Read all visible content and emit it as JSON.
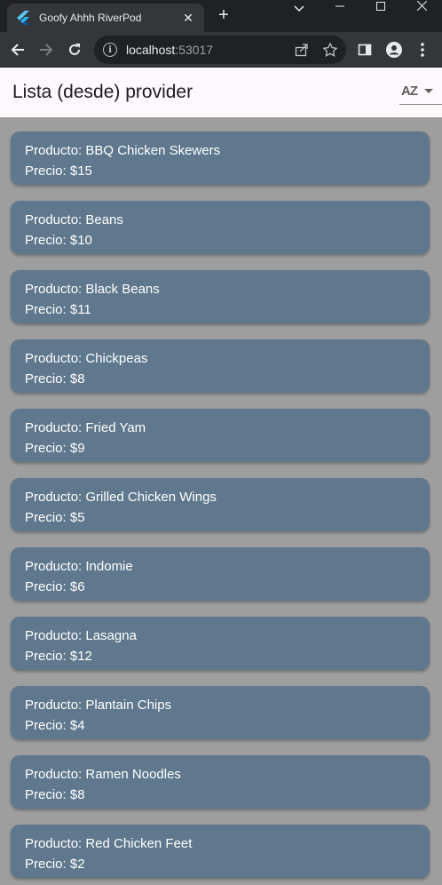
{
  "browser": {
    "tab_title": "Goofy Ahhh RiverPod",
    "url_host": "localhost",
    "url_port": ":53017"
  },
  "app": {
    "title": "Lista (desde) provider",
    "sort_icon": "AZ"
  },
  "products": [
    {
      "name": "Producto: BBQ Chicken Skewers",
      "price": "Precio: $15"
    },
    {
      "name": "Producto: Beans",
      "price": "Precio: $10"
    },
    {
      "name": "Producto: Black Beans",
      "price": "Precio: $11"
    },
    {
      "name": "Producto: Chickpeas",
      "price": "Precio: $8"
    },
    {
      "name": "Producto: Fried Yam",
      "price": "Precio: $9"
    },
    {
      "name": "Producto: Grilled Chicken Wings",
      "price": "Precio: $5"
    },
    {
      "name": "Producto: Indomie",
      "price": "Precio: $6"
    },
    {
      "name": "Producto: Lasagna",
      "price": "Precio: $12"
    },
    {
      "name": "Producto: Plantain Chips",
      "price": "Precio: $4"
    },
    {
      "name": "Producto: Ramen Noodles",
      "price": "Precio: $8"
    },
    {
      "name": "Producto: Red Chicken Feet",
      "price": "Precio: $2"
    }
  ]
}
